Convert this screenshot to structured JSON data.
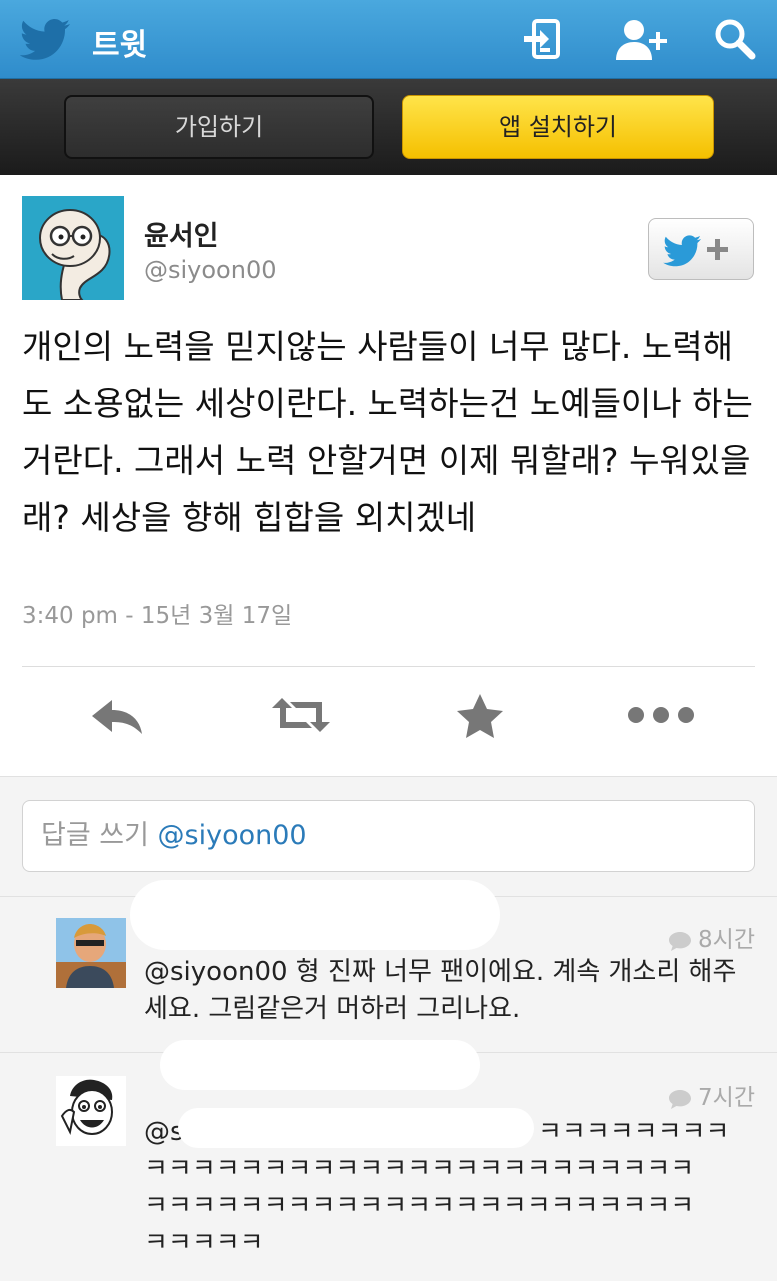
{
  "topbar": {
    "title": "트윗",
    "icons": [
      "twitter-bird-icon",
      "sign-in-icon",
      "add-user-icon",
      "search-icon"
    ],
    "color": "#3a9ad6"
  },
  "signup": {
    "join_label": "가입하기",
    "install_label": "앱 설치하기",
    "install_color": "#f8cb14"
  },
  "tweet": {
    "author_name": "윤서인",
    "author_handle": "@siyoon00",
    "text": "개인의 노력을 믿지않는 사람들이 너무 많다. 노력해도 소용없는 세상이란다. 노력하는건 노예들이나 하는거란다. 그래서 노력 안할거면 이제 뭐할래? 누워있을래? 세상을 향해 힙합을 외치겠네",
    "timestamp": "3:40 pm - 15년 3월 17일",
    "actions": [
      "reply-icon",
      "retweet-icon",
      "favorite-icon",
      "more-icon"
    ]
  },
  "reply_box": {
    "placeholder": "답글 쓰기",
    "mention": "@siyoon00"
  },
  "replies": [
    {
      "time": "8시간",
      "text": "@siyoon00 형 진짜 너무 팬이에요. 계속 개소리 해주세요. 그림같은거 머하러 그리나요."
    },
    {
      "time": "7시간",
      "text_line1": "@s",
      "text_line1_end": "ㅋㅋㅋㅋㅋㅋㅋㅋ",
      "text_line2": "ㅋㅋㅋㅋㅋㅋㅋㅋㅋㅋㅋㅋㅋㅋㅋㅋㅋㅋㅋㅋㅋㅋㅋ",
      "text_line3": "ㅋㅋㅋㅋㅋㅋㅋㅋㅋㅋㅋㅋㅋㅋㅋㅋㅋㅋㅋㅋㅋㅋㅋ",
      "text_line4": "ㅋㅋㅋㅋㅋ"
    }
  ]
}
